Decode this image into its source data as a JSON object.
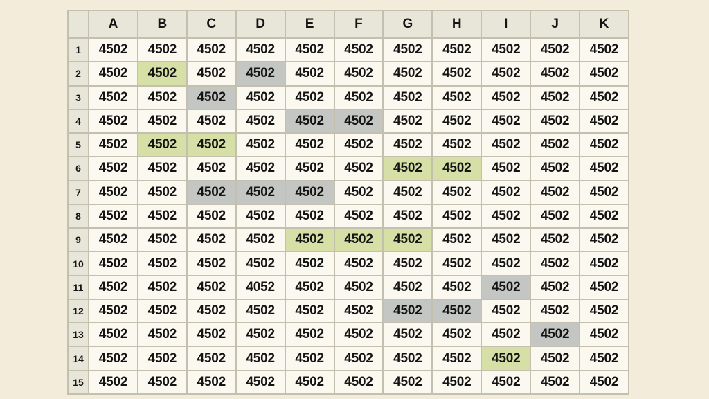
{
  "grid": {
    "columns": [
      "A",
      "B",
      "C",
      "D",
      "E",
      "F",
      "G",
      "H",
      "I",
      "J",
      "K"
    ],
    "rows": [
      {
        "label": "1",
        "cells": [
          "4502",
          "4502",
          "4502",
          "4502",
          "4502",
          "4502",
          "4502",
          "4502",
          "4502",
          "4502",
          "4502"
        ]
      },
      {
        "label": "2",
        "cells": [
          "4502",
          "4502",
          "4502",
          "4502",
          "4502",
          "4502",
          "4502",
          "4502",
          "4502",
          "4502",
          "4502"
        ]
      },
      {
        "label": "3",
        "cells": [
          "4502",
          "4502",
          "4502",
          "4502",
          "4502",
          "4502",
          "4502",
          "4502",
          "4502",
          "4502",
          "4502"
        ]
      },
      {
        "label": "4",
        "cells": [
          "4502",
          "4502",
          "4502",
          "4502",
          "4502",
          "4502",
          "4502",
          "4502",
          "4502",
          "4502",
          "4502"
        ]
      },
      {
        "label": "5",
        "cells": [
          "4502",
          "4502",
          "4502",
          "4502",
          "4502",
          "4502",
          "4502",
          "4502",
          "4502",
          "4502",
          "4502"
        ]
      },
      {
        "label": "6",
        "cells": [
          "4502",
          "4502",
          "4502",
          "4502",
          "4502",
          "4502",
          "4502",
          "4502",
          "4502",
          "4502",
          "4502"
        ]
      },
      {
        "label": "7",
        "cells": [
          "4502",
          "4502",
          "4502",
          "4502",
          "4502",
          "4502",
          "4502",
          "4502",
          "4502",
          "4502",
          "4502"
        ]
      },
      {
        "label": "8",
        "cells": [
          "4502",
          "4502",
          "4502",
          "4502",
          "4502",
          "4502",
          "4502",
          "4502",
          "4502",
          "4502",
          "4502"
        ]
      },
      {
        "label": "9",
        "cells": [
          "4502",
          "4502",
          "4502",
          "4502",
          "4502",
          "4502",
          "4502",
          "4502",
          "4502",
          "4502",
          "4502"
        ]
      },
      {
        "label": "10",
        "cells": [
          "4502",
          "4502",
          "4502",
          "4502",
          "4502",
          "4502",
          "4502",
          "4502",
          "4502",
          "4502",
          "4502"
        ]
      },
      {
        "label": "11",
        "cells": [
          "4502",
          "4502",
          "4502",
          "4052",
          "4502",
          "4502",
          "4502",
          "4502",
          "4502",
          "4502",
          "4502"
        ]
      },
      {
        "label": "12",
        "cells": [
          "4502",
          "4502",
          "4502",
          "4502",
          "4502",
          "4502",
          "4502",
          "4502",
          "4502",
          "4502",
          "4502"
        ]
      },
      {
        "label": "13",
        "cells": [
          "4502",
          "4502",
          "4502",
          "4502",
          "4502",
          "4502",
          "4502",
          "4502",
          "4502",
          "4502",
          "4502"
        ]
      },
      {
        "label": "14",
        "cells": [
          "4502",
          "4502",
          "4502",
          "4502",
          "4502",
          "4502",
          "4502",
          "4502",
          "4502",
          "4502",
          "4502"
        ]
      },
      {
        "label": "15",
        "cells": [
          "4502",
          "4502",
          "4502",
          "4502",
          "4502",
          "4502",
          "4502",
          "4502",
          "4502",
          "4502",
          "4502"
        ]
      }
    ],
    "highlights": {
      "green": [
        "B2",
        "B5",
        "C5",
        "G6",
        "H6",
        "E9",
        "F9",
        "G9",
        "I14"
      ],
      "gray": [
        "D2",
        "C3",
        "E4",
        "F4",
        "C7",
        "D7",
        "E7",
        "I11",
        "G12",
        "H12",
        "J13"
      ]
    },
    "colors": {
      "green": "#d6dfa6",
      "gray": "#c3c6c2"
    }
  }
}
